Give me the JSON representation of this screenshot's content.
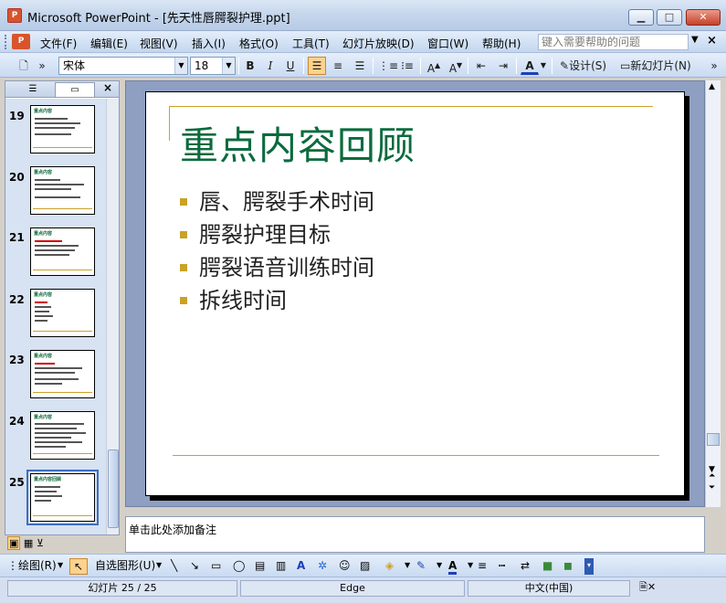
{
  "window": {
    "title": "Microsoft PowerPoint - [先天性唇腭裂护理.ppt]",
    "app_icon": "P"
  },
  "menu": {
    "items": [
      "文件(F)",
      "编辑(E)",
      "视图(V)",
      "插入(I)",
      "格式(O)",
      "工具(T)",
      "幻灯片放映(D)",
      "窗口(W)",
      "帮助(H)"
    ],
    "help_placeholder": "键入需要帮助的问题"
  },
  "format_toolbar": {
    "font_name": "宋体",
    "font_size": "18",
    "bold": "B",
    "italic": "I",
    "underline": "U",
    "design_label": "设计(S)",
    "new_slide_label": "新幻灯片(N)"
  },
  "thumbnails": [
    {
      "number": "19",
      "title": "重点内容"
    },
    {
      "number": "20",
      "title": "重点内容"
    },
    {
      "number": "21",
      "title": "重点内容"
    },
    {
      "number": "22",
      "title": "重点内容"
    },
    {
      "number": "23",
      "title": "重点内容"
    },
    {
      "number": "24",
      "title": "重点内容"
    },
    {
      "number": "25",
      "title": "重点内容回顾"
    }
  ],
  "slide": {
    "title": "重点内容回顾",
    "bullets": [
      "唇、腭裂手术时间",
      "腭裂护理目标",
      "腭裂语音训练时间",
      "拆线时间"
    ]
  },
  "notes": {
    "placeholder": "单击此处添加备注"
  },
  "drawing_toolbar": {
    "draw_label": "绘图(R)",
    "autoshapes_label": "自选图形(U)"
  },
  "status": {
    "slide_position": "幻灯片 25 / 25",
    "design_name": "Edge",
    "language": "中文(中国)"
  },
  "colors": {
    "title_green": "#0b6b3e",
    "accent_gold": "#c9a227",
    "work_bg": "#8e9fc2"
  }
}
